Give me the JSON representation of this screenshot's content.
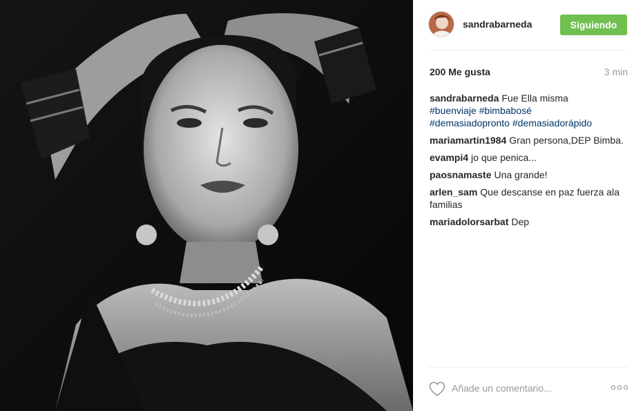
{
  "post": {
    "username": "sandrabarneda",
    "follow_label": "Siguiendo",
    "likes_text": "200 Me gusta",
    "time_ago": "3 min",
    "caption": {
      "username": "sandrabarneda",
      "text": "Fue Ella misma",
      "hashtags": [
        "#buenviaje",
        "#bimbabosé",
        "#demasiadopronto",
        "#demasiadorápido"
      ]
    },
    "comments": [
      {
        "username": "mariamartin1984",
        "text": "Gran persona,DEP Bimba."
      },
      {
        "username": "evampi4",
        "text": "jo que penica..."
      },
      {
        "username": "paosnamaste",
        "text": "Una grande!"
      },
      {
        "username": "arlen_sam",
        "text": "Que descanse en paz fuerza ala familias"
      },
      {
        "username": "mariadolorsarbat",
        "text": "Dep"
      }
    ],
    "add_comment_placeholder": "Añade un comentario...",
    "icons": {
      "like": "heart-icon",
      "options": "more-options-icon"
    },
    "colors": {
      "follow_button": "#70c050",
      "hashtag": "#003569",
      "muted": "#999999"
    }
  }
}
